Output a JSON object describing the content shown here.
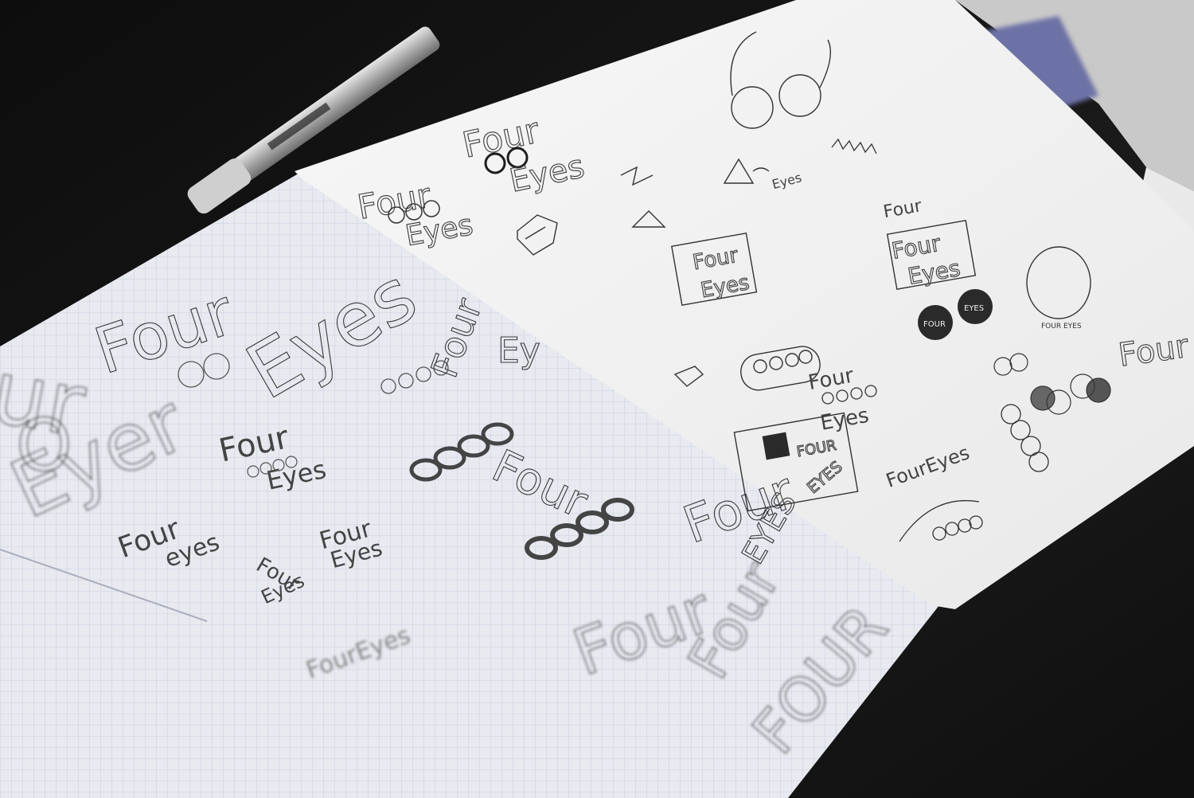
{
  "photo": {
    "subject": "pen-and-pencil logo sketches",
    "colors": {
      "table": "#141414",
      "grid_paper": "#e8eaf0",
      "grid_line": "#b9c2d6",
      "plain_paper": "#f2f2f2",
      "pencil": "#3a3a3a",
      "ink": "#1e1e1e"
    },
    "sketches": {
      "large_four": "Four",
      "large_eyes": "Eyes",
      "left_o": "O",
      "left_eyer": "Eyer",
      "left_four_partial": "ur",
      "vertical_four": "Four",
      "vertical_ey": "Ey",
      "four_1": "Four",
      "eyes_1": "Eyes",
      "four_2": "Four",
      "eyes_2": "eyes",
      "four_3": "Four",
      "eyes_3": "Eyes",
      "four_4": "Four",
      "eyes_4": "Eyes",
      "four_5": "Four",
      "four_6": "Four",
      "eyes_6": "EYES",
      "four_7": "Four",
      "four_8": "Four",
      "four_9": "FOUR",
      "top_four": "Four",
      "top_eyes": "Eyes",
      "left_four": "Four",
      "left_eyes": "Eyes",
      "tri_eyes": "Eyes",
      "boxed_four": "Four",
      "boxed_eyes": "Eyes",
      "small_four": "Four",
      "framed_four": "Four",
      "framed_eyes": "Eyes",
      "circle_text_1": "FOUR",
      "circle_text_2": "EYES",
      "badge_text": "FOUR EYES",
      "stacked_four": "Four",
      "stacked_eyes": "Eyes",
      "four_eyes_line": "FourEyes",
      "poster_four": "FOUR",
      "poster_eyes": "EYES",
      "arc_text": "FourEyes",
      "right_edge": "Four"
    }
  }
}
